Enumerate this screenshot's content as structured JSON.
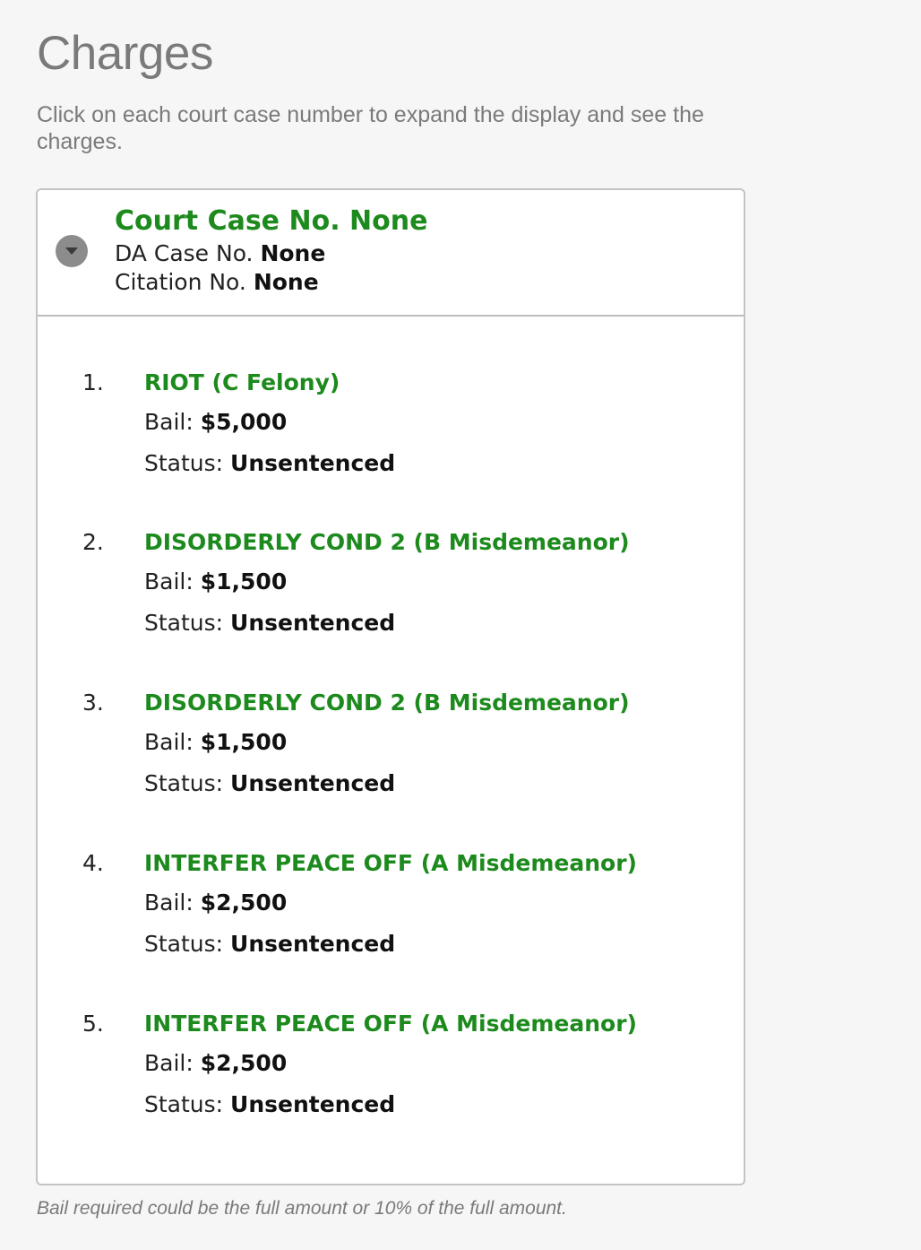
{
  "page": {
    "title": "Charges",
    "intro": "Click on each court case number to expand the display and see the charges.",
    "footnote": "Bail required could be the full amount or 10% of the full amount."
  },
  "case": {
    "court_case_title": "Court Case No. None",
    "da_case_label": "DA Case No.",
    "da_case_value": "None",
    "citation_label": "Citation No.",
    "citation_value": "None",
    "toggle_icon": "chevron-down-icon",
    "expanded": true
  },
  "labels": {
    "bail": "Bail:",
    "status": "Status:"
  },
  "charges": [
    {
      "number": "1.",
      "name": "RIOT (C Felony)",
      "bail": "$5,000",
      "status": "Unsentenced"
    },
    {
      "number": "2.",
      "name": "DISORDERLY COND 2 (B Misdemeanor)",
      "bail": "$1,500",
      "status": "Unsentenced"
    },
    {
      "number": "3.",
      "name": "DISORDERLY COND 2 (B Misdemeanor)",
      "bail": "$1,500",
      "status": "Unsentenced"
    },
    {
      "number": "4.",
      "name": "INTERFER PEACE OFF (A Misdemeanor)",
      "bail": "$2,500",
      "status": "Unsentenced"
    },
    {
      "number": "5.",
      "name": "INTERFER PEACE OFF (A Misdemeanor)",
      "bail": "$2,500",
      "status": "Unsentenced"
    }
  ],
  "colors": {
    "accent_green": "#1d8a1d",
    "muted_text": "#7a7a7a",
    "toggle_gray": "#8c8c8c"
  }
}
